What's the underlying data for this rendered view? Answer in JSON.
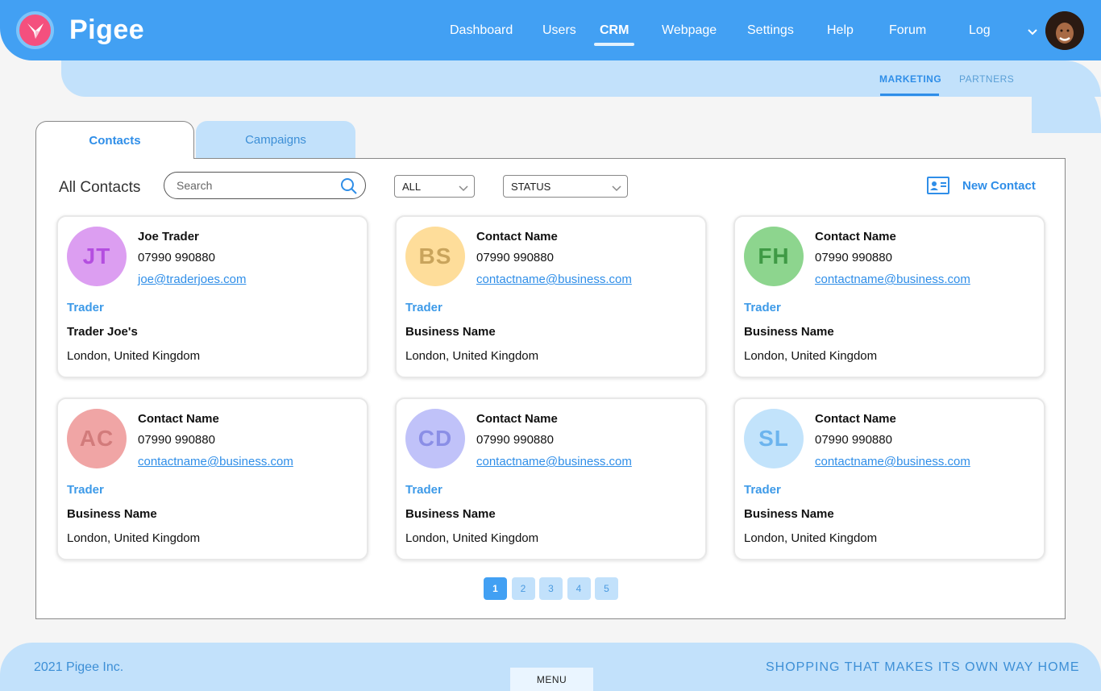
{
  "brand": {
    "name": "Pigee"
  },
  "nav": {
    "items": [
      "Dashboard",
      "Users",
      "CRM",
      "Webpage",
      "Settings",
      "Help",
      "Forum",
      "Log"
    ],
    "active": "CRM"
  },
  "subnav": {
    "items": [
      "MARKETING",
      "PARTNERS"
    ],
    "active": "MARKETING"
  },
  "tabs": {
    "contacts": "Contacts",
    "campaigns": "Campaigns"
  },
  "toolbar": {
    "title": "All Contacts",
    "search_placeholder": "Search",
    "filter_all": "ALL",
    "filter_status": "STATUS",
    "new_contact": "New Contact"
  },
  "contacts": [
    {
      "initials": "JT",
      "name": "Joe Trader",
      "phone": "07990 990880",
      "email": "joe@traderjoes.com",
      "role": "Trader",
      "business": "Trader Joe's",
      "location": "London, United Kingdom",
      "bg": "#dc9ef1",
      "fg": "#b44ee0"
    },
    {
      "initials": "BS",
      "name": "Contact Name",
      "phone": "07990 990880",
      "email": "contactname@business.com",
      "role": "Trader",
      "business": "Business Name",
      "location": "London, United Kingdom",
      "bg": "#fedd9a",
      "fg": "#c9a45c"
    },
    {
      "initials": "FH",
      "name": "Contact Name",
      "phone": "07990 990880",
      "email": "contactname@business.com",
      "role": "Trader",
      "business": "Business Name",
      "location": "London, United Kingdom",
      "bg": "#8dd58e",
      "fg": "#3f9a45"
    },
    {
      "initials": "AC",
      "name": "Contact Name",
      "phone": "07990 990880",
      "email": "contactname@business.com",
      "role": "Trader",
      "business": "Business Name",
      "location": "London, United Kingdom",
      "bg": "#f0a5a5",
      "fg": "#d27b7b"
    },
    {
      "initials": "CD",
      "name": "Contact Name",
      "phone": "07990 990880",
      "email": "contactname@business.com",
      "role": "Trader",
      "business": "Business Name",
      "location": "London, United Kingdom",
      "bg": "#c0c2f9",
      "fg": "#8a8ee6"
    },
    {
      "initials": "SL",
      "name": "Contact Name",
      "phone": "07990 990880",
      "email": "contactname@business.com",
      "role": "Trader",
      "business": "Business Name",
      "location": "London, United Kingdom",
      "bg": "#c2e3fb",
      "fg": "#6cb4ee"
    }
  ],
  "pagination": {
    "pages": [
      "1",
      "2",
      "3",
      "4",
      "5"
    ],
    "active": "1"
  },
  "footer": {
    "copyright": "2021 Pigee Inc.",
    "tagline": "SHOPPING THAT MAKES ITS OWN WAY HOME",
    "menu": "MENU"
  },
  "colors": {
    "primary": "#42a0f3",
    "light": "#c2e1fb",
    "accent": "#f4507e"
  }
}
